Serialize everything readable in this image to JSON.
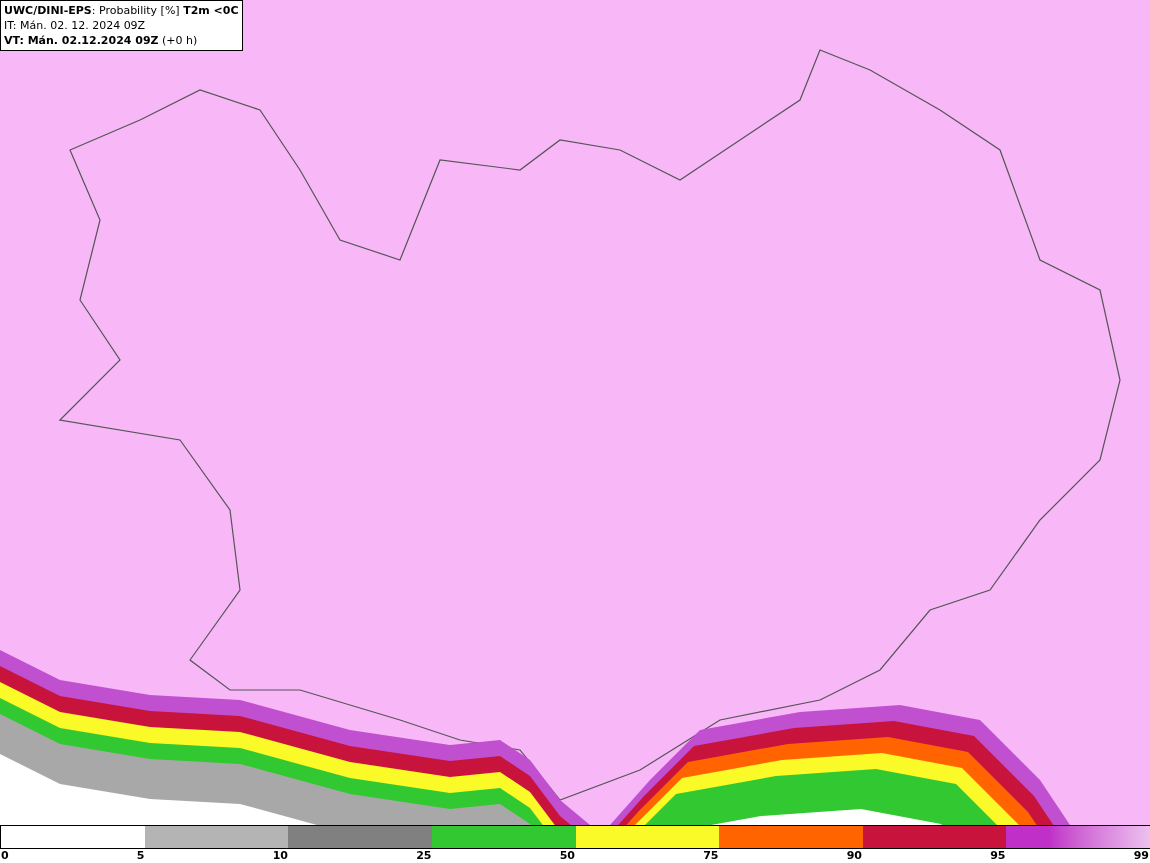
{
  "map": {
    "title_lines": [
      "**UWC/DINI-EPS**: Probability [%] **T2m <0C**",
      "IT: Mán. 02. 12. 2024 09Z",
      "**VT: Mán. 02.12.2024 09Z** (+0 h)"
    ]
  },
  "legend": {
    "segments": [
      {
        "color": "#ffffff"
      },
      {
        "color": "#b4b4b4"
      },
      {
        "color": "#808080"
      },
      {
        "color": "#32c832"
      },
      {
        "color": "#fafa28"
      },
      {
        "color": "#ff6400"
      },
      {
        "color": "#c8143c"
      },
      {
        "color": "#c030c8"
      }
    ],
    "labels": [
      "0",
      "5",
      "10",
      "25",
      "50",
      "75",
      "90",
      "95",
      "99"
    ]
  }
}
